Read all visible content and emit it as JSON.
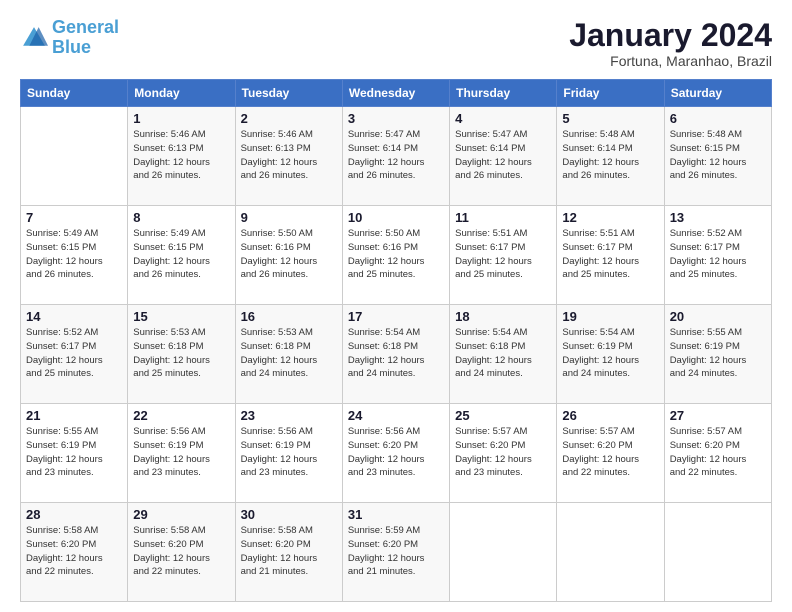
{
  "header": {
    "logo_line1": "General",
    "logo_line2": "Blue",
    "month_title": "January 2024",
    "subtitle": "Fortuna, Maranhao, Brazil"
  },
  "weekdays": [
    "Sunday",
    "Monday",
    "Tuesday",
    "Wednesday",
    "Thursday",
    "Friday",
    "Saturday"
  ],
  "weeks": [
    [
      {
        "day": "",
        "info": ""
      },
      {
        "day": "1",
        "info": "Sunrise: 5:46 AM\nSunset: 6:13 PM\nDaylight: 12 hours\nand 26 minutes."
      },
      {
        "day": "2",
        "info": "Sunrise: 5:46 AM\nSunset: 6:13 PM\nDaylight: 12 hours\nand 26 minutes."
      },
      {
        "day": "3",
        "info": "Sunrise: 5:47 AM\nSunset: 6:14 PM\nDaylight: 12 hours\nand 26 minutes."
      },
      {
        "day": "4",
        "info": "Sunrise: 5:47 AM\nSunset: 6:14 PM\nDaylight: 12 hours\nand 26 minutes."
      },
      {
        "day": "5",
        "info": "Sunrise: 5:48 AM\nSunset: 6:14 PM\nDaylight: 12 hours\nand 26 minutes."
      },
      {
        "day": "6",
        "info": "Sunrise: 5:48 AM\nSunset: 6:15 PM\nDaylight: 12 hours\nand 26 minutes."
      }
    ],
    [
      {
        "day": "7",
        "info": "Sunrise: 5:49 AM\nSunset: 6:15 PM\nDaylight: 12 hours\nand 26 minutes."
      },
      {
        "day": "8",
        "info": "Sunrise: 5:49 AM\nSunset: 6:15 PM\nDaylight: 12 hours\nand 26 minutes."
      },
      {
        "day": "9",
        "info": "Sunrise: 5:50 AM\nSunset: 6:16 PM\nDaylight: 12 hours\nand 26 minutes."
      },
      {
        "day": "10",
        "info": "Sunrise: 5:50 AM\nSunset: 6:16 PM\nDaylight: 12 hours\nand 25 minutes."
      },
      {
        "day": "11",
        "info": "Sunrise: 5:51 AM\nSunset: 6:17 PM\nDaylight: 12 hours\nand 25 minutes."
      },
      {
        "day": "12",
        "info": "Sunrise: 5:51 AM\nSunset: 6:17 PM\nDaylight: 12 hours\nand 25 minutes."
      },
      {
        "day": "13",
        "info": "Sunrise: 5:52 AM\nSunset: 6:17 PM\nDaylight: 12 hours\nand 25 minutes."
      }
    ],
    [
      {
        "day": "14",
        "info": "Sunrise: 5:52 AM\nSunset: 6:17 PM\nDaylight: 12 hours\nand 25 minutes."
      },
      {
        "day": "15",
        "info": "Sunrise: 5:53 AM\nSunset: 6:18 PM\nDaylight: 12 hours\nand 25 minutes."
      },
      {
        "day": "16",
        "info": "Sunrise: 5:53 AM\nSunset: 6:18 PM\nDaylight: 12 hours\nand 24 minutes."
      },
      {
        "day": "17",
        "info": "Sunrise: 5:54 AM\nSunset: 6:18 PM\nDaylight: 12 hours\nand 24 minutes."
      },
      {
        "day": "18",
        "info": "Sunrise: 5:54 AM\nSunset: 6:18 PM\nDaylight: 12 hours\nand 24 minutes."
      },
      {
        "day": "19",
        "info": "Sunrise: 5:54 AM\nSunset: 6:19 PM\nDaylight: 12 hours\nand 24 minutes."
      },
      {
        "day": "20",
        "info": "Sunrise: 5:55 AM\nSunset: 6:19 PM\nDaylight: 12 hours\nand 24 minutes."
      }
    ],
    [
      {
        "day": "21",
        "info": "Sunrise: 5:55 AM\nSunset: 6:19 PM\nDaylight: 12 hours\nand 23 minutes."
      },
      {
        "day": "22",
        "info": "Sunrise: 5:56 AM\nSunset: 6:19 PM\nDaylight: 12 hours\nand 23 minutes."
      },
      {
        "day": "23",
        "info": "Sunrise: 5:56 AM\nSunset: 6:19 PM\nDaylight: 12 hours\nand 23 minutes."
      },
      {
        "day": "24",
        "info": "Sunrise: 5:56 AM\nSunset: 6:20 PM\nDaylight: 12 hours\nand 23 minutes."
      },
      {
        "day": "25",
        "info": "Sunrise: 5:57 AM\nSunset: 6:20 PM\nDaylight: 12 hours\nand 23 minutes."
      },
      {
        "day": "26",
        "info": "Sunrise: 5:57 AM\nSunset: 6:20 PM\nDaylight: 12 hours\nand 22 minutes."
      },
      {
        "day": "27",
        "info": "Sunrise: 5:57 AM\nSunset: 6:20 PM\nDaylight: 12 hours\nand 22 minutes."
      }
    ],
    [
      {
        "day": "28",
        "info": "Sunrise: 5:58 AM\nSunset: 6:20 PM\nDaylight: 12 hours\nand 22 minutes."
      },
      {
        "day": "29",
        "info": "Sunrise: 5:58 AM\nSunset: 6:20 PM\nDaylight: 12 hours\nand 22 minutes."
      },
      {
        "day": "30",
        "info": "Sunrise: 5:58 AM\nSunset: 6:20 PM\nDaylight: 12 hours\nand 21 minutes."
      },
      {
        "day": "31",
        "info": "Sunrise: 5:59 AM\nSunset: 6:20 PM\nDaylight: 12 hours\nand 21 minutes."
      },
      {
        "day": "",
        "info": ""
      },
      {
        "day": "",
        "info": ""
      },
      {
        "day": "",
        "info": ""
      }
    ]
  ]
}
